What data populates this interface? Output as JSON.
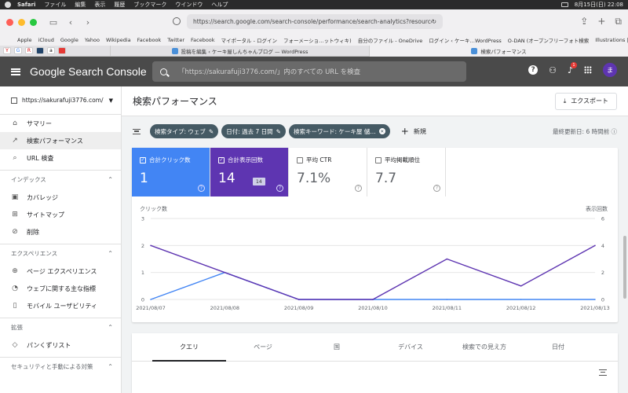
{
  "menubar": {
    "items": [
      "Safari",
      "ファイル",
      "編集",
      "表示",
      "履歴",
      "ブックマーク",
      "ウインドウ",
      "ヘルプ"
    ],
    "clock": "8月15日(日) 22:08"
  },
  "browser": {
    "url": "https://search.google.com/search-console/performance/search-analytics?resource_id=",
    "bookmarks": [
      "Apple",
      "iCloud",
      "Google",
      "Yahoo",
      "Wikipedia",
      "Facebook",
      "Twitter",
      "Facebook",
      "マイポータル - ログイン",
      "フォーメーショ…ットウィキ)",
      "自分のファイル - OneDrive",
      "ログイン ‹ ケーキ…WordPress",
      "O-DAN (オープンフリーフォト検索",
      "Illustrations | unDraw"
    ],
    "favicon_labels": [
      "Y",
      "G",
      "R",
      "",
      "a",
      ""
    ],
    "tabs": [
      {
        "label": "投稿を編集 ‹ ケーキ屋しんちゃんブログ — WordPress",
        "active": false
      },
      {
        "label": "検索パフォーマンス",
        "active": true
      }
    ]
  },
  "header": {
    "logo": "Google Search Console",
    "search_placeholder": "「https://sakurafuji3776.com/」内のすべての URL を検査",
    "notification_count": "1",
    "avatar_letter": "ま"
  },
  "sidebar": {
    "property": "https://sakurafuji3776.com/",
    "items": [
      {
        "label": "サマリー",
        "icon": "home-icon",
        "glyph": "⌂",
        "active": false
      },
      {
        "label": "検索パフォーマンス",
        "icon": "trending-icon",
        "glyph": "↗",
        "active": true
      },
      {
        "label": "URL 検査",
        "icon": "search-icon",
        "glyph": "⌕",
        "active": false
      }
    ],
    "sections": [
      {
        "title": "インデックス",
        "items": [
          {
            "label": "カバレッジ",
            "icon": "coverage-icon",
            "glyph": "▣"
          },
          {
            "label": "サイトマップ",
            "icon": "sitemap-icon",
            "glyph": "⊞"
          },
          {
            "label": "削除",
            "icon": "removal-icon",
            "glyph": "⊘"
          }
        ]
      },
      {
        "title": "エクスペリエンス",
        "items": [
          {
            "label": "ページ エクスペリエンス",
            "icon": "experience-icon",
            "glyph": "⊕"
          },
          {
            "label": "ウェブに関する主な指標",
            "icon": "gauge-icon",
            "glyph": "◔"
          },
          {
            "label": "モバイル ユーザビリティ",
            "icon": "mobile-icon",
            "glyph": "▯"
          }
        ]
      },
      {
        "title": "拡張",
        "items": [
          {
            "label": "パンくずリスト",
            "icon": "breadcrumb-icon",
            "glyph": "◇"
          }
        ]
      },
      {
        "title": "セキュリティと手動による対策",
        "items": []
      }
    ]
  },
  "main": {
    "title": "検索パフォーマンス",
    "export_label": "エクスポート",
    "filters": [
      "検索タイプ: ウェブ",
      "日付: 過去 7 日間",
      "検索キーワード: ケーキ屋 儲…"
    ],
    "new_label": "新規",
    "last_updated": "最終更新日: 6 時間前",
    "metrics": [
      {
        "label": "合計クリック数",
        "value": "1",
        "checked": true
      },
      {
        "label": "合計表示回数",
        "value": "14",
        "checked": true,
        "tooltip": "14"
      },
      {
        "label": "平均 CTR",
        "value": "7.1%",
        "checked": false
      },
      {
        "label": "平均掲載順位",
        "value": "7.7",
        "checked": false
      }
    ],
    "tabs": [
      "クエリ",
      "ページ",
      "国",
      "デバイス",
      "検索での見え方",
      "日付"
    ]
  },
  "chart_data": {
    "type": "line",
    "x": [
      "2021/08/07",
      "2021/08/08",
      "2021/08/09",
      "2021/08/10",
      "2021/08/11",
      "2021/08/12",
      "2021/08/13"
    ],
    "ylabel_left": "クリック数",
    "ylabel_right": "表示回数",
    "ylim_left": [
      0,
      3
    ],
    "ylim_right": [
      0,
      6
    ],
    "ticks_left": [
      "3",
      "2",
      "1",
      "0"
    ],
    "ticks_right": [
      "6",
      "4",
      "2",
      "0"
    ],
    "series": [
      {
        "name": "合計クリック数",
        "axis": "left",
        "color": "#4285f4",
        "values": [
          0,
          1,
          0,
          0,
          0,
          0,
          0
        ]
      },
      {
        "name": "合計表示回数",
        "axis": "right",
        "color": "#5e35b1",
        "values": [
          4,
          2,
          0,
          0,
          3,
          1,
          4
        ]
      }
    ]
  }
}
